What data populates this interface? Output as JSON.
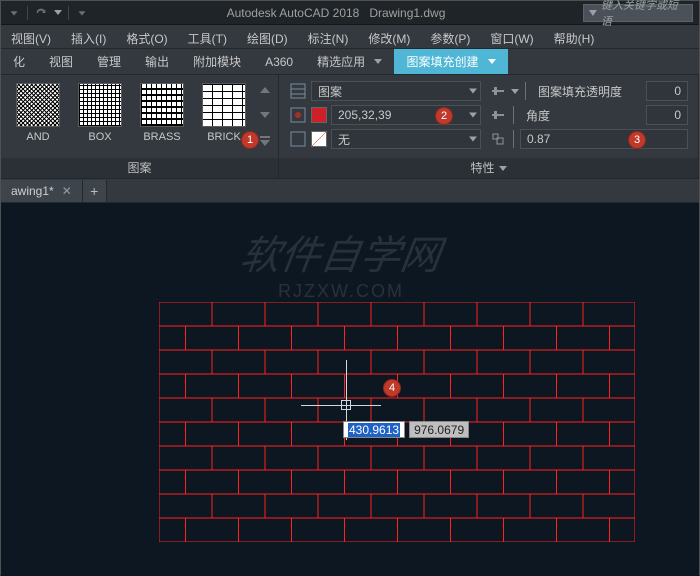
{
  "title": {
    "app": "Autodesk AutoCAD 2018",
    "file": "Drawing1.dwg"
  },
  "search": {
    "placeholder": "键入关键字或短语"
  },
  "menus": [
    {
      "label": "视图(V)"
    },
    {
      "label": "插入(I)"
    },
    {
      "label": "格式(O)"
    },
    {
      "label": "工具(T)"
    },
    {
      "label": "绘图(D)"
    },
    {
      "label": "标注(N)"
    },
    {
      "label": "修改(M)"
    },
    {
      "label": "参数(P)"
    },
    {
      "label": "窗口(W)"
    },
    {
      "label": "帮助(H)"
    }
  ],
  "tabs": [
    {
      "label": "化"
    },
    {
      "label": "视图"
    },
    {
      "label": "管理"
    },
    {
      "label": "输出"
    },
    {
      "label": "附加模块"
    },
    {
      "label": "A360"
    },
    {
      "label": "精选应用"
    },
    {
      "label": "图案填充创建",
      "active": true
    }
  ],
  "panels": {
    "patterns": {
      "title": "图案",
      "items": [
        {
          "name": "AND"
        },
        {
          "name": "BOX"
        },
        {
          "name": "BRASS"
        },
        {
          "name": "BRICK"
        }
      ]
    },
    "props": {
      "title": "特性",
      "pattern_dd": "图案",
      "color": "205,32,39",
      "none": "无",
      "opacity_label": "图案填充透明度",
      "opacity_val": "0",
      "angle_label": "角度",
      "angle_val": "0",
      "scale_val": "0.87"
    }
  },
  "doctab": {
    "name": "awing1*"
  },
  "badges": {
    "b1": "1",
    "b2": "2",
    "b3": "3",
    "b4": "4"
  },
  "cursor": {
    "xval": "430.9613",
    "yval": "976.0679"
  },
  "watermark": {
    "text1": "软件自学网",
    "text2": "RJZXW.COM"
  }
}
